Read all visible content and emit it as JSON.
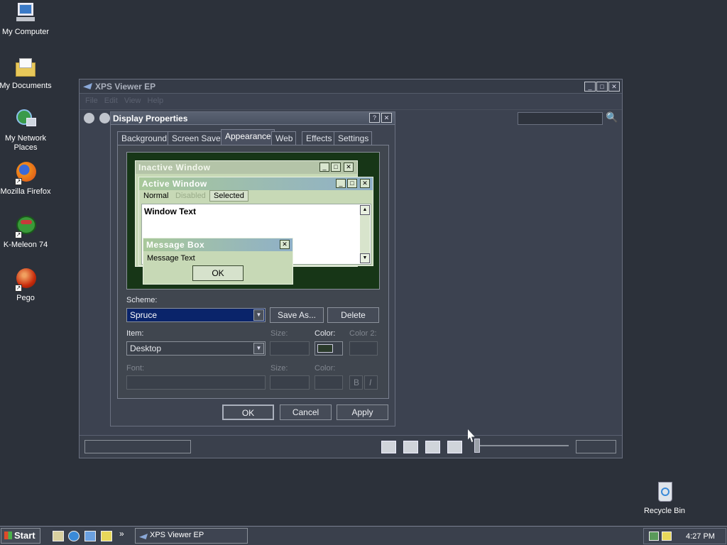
{
  "desktop": {
    "icons": [
      {
        "label": "My Computer",
        "icon": "computer-icon"
      },
      {
        "label": "My Documents",
        "icon": "folder-icon"
      },
      {
        "label": "My Network Places",
        "icon": "network-icon"
      },
      {
        "label": "Mozilla Firefox",
        "icon": "firefox-icon"
      },
      {
        "label": "K-Meleon 74",
        "icon": "kmeleon-icon"
      },
      {
        "label": "Pego",
        "icon": "pego-icon"
      },
      {
        "label": "Recycle Bin",
        "icon": "recycle-bin-icon"
      }
    ]
  },
  "xps": {
    "title": "XPS Viewer EP",
    "menu": [
      "File",
      "Edit",
      "View",
      "Help"
    ]
  },
  "dialog": {
    "title": "Display Properties",
    "tabs": [
      "Background",
      "Screen Saver",
      "Appearance",
      "Web",
      "Effects",
      "Settings"
    ],
    "selected_tab": "Appearance",
    "preview": {
      "inactive_title": "Inactive Window",
      "active_title": "Active Window",
      "menu_normal": "Normal",
      "menu_disabled": "Disabled",
      "menu_selected": "Selected",
      "window_text": "Window Text",
      "msgbox_title": "Message Box",
      "msgbox_text": "Message Text",
      "msgbox_ok": "OK"
    },
    "scheme_label": "Scheme:",
    "scheme_value": "Spruce",
    "save_as": "Save As...",
    "delete": "Delete",
    "item_label": "Item:",
    "item_value": "Desktop",
    "size_label": "Size:",
    "color_label": "Color:",
    "color2_label": "Color 2:",
    "font_label": "Font:",
    "size2_label": "Size:",
    "color3_label": "Color:",
    "bold": "B",
    "italic": "I",
    "ok": "OK",
    "cancel": "Cancel",
    "apply": "Apply",
    "desktop_color": "#2a3a2a"
  },
  "taskbar": {
    "start": "Start",
    "task": "XPS Viewer EP",
    "clock": "4:27 PM",
    "chevron": "»"
  },
  "colors": {
    "desktop": "#2c313a",
    "scheme_highlight": "#0a246a",
    "active_title": "#8fb0c8",
    "inactive_title": "#b4c4a8"
  }
}
